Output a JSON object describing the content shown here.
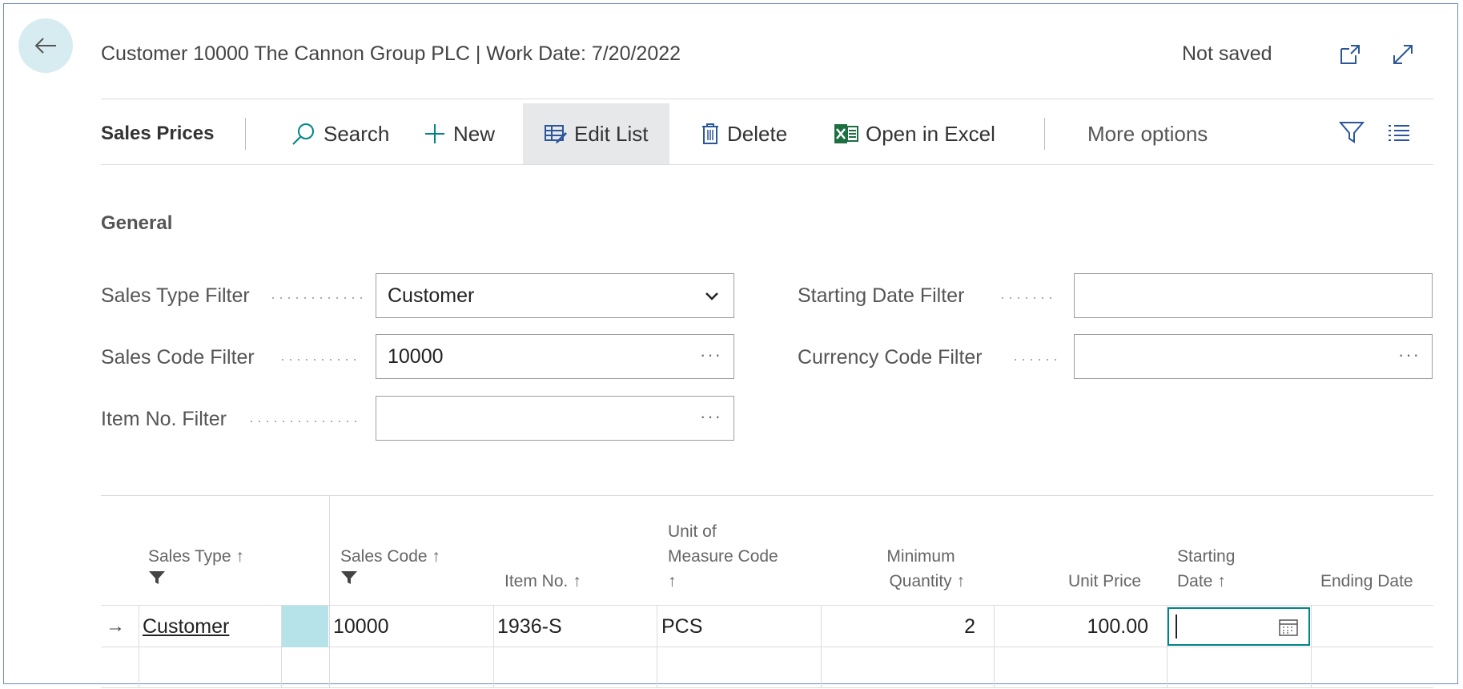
{
  "header": {
    "title": "Customer 10000 The Cannon Group PLC | Work Date: 7/20/2022",
    "status": "Not saved"
  },
  "actionbar": {
    "page_name": "Sales Prices",
    "search": "Search",
    "new": "New",
    "edit_list": "Edit List",
    "delete": "Delete",
    "open_in_excel": "Open in Excel",
    "more_options": "More options"
  },
  "general": {
    "section_title": "General",
    "sales_type_filter": {
      "label": "Sales Type Filter",
      "value": "Customer"
    },
    "sales_code_filter": {
      "label": "Sales Code Filter",
      "value": "10000"
    },
    "item_no_filter": {
      "label": "Item No. Filter",
      "value": ""
    },
    "starting_date_filter": {
      "label": "Starting Date Filter",
      "value": ""
    },
    "currency_code_filter": {
      "label": "Currency Code Filter",
      "value": ""
    }
  },
  "table": {
    "columns": {
      "sales_type": "Sales Type ↑",
      "sales_code": "Sales Code ↑",
      "item_no": "Item No. ↑",
      "uom_line1": "Unit of",
      "uom_line2": "Measure Code",
      "uom_line3": "↑",
      "min_qty_line1": "Minimum",
      "min_qty_line2": "Quantity ↑",
      "unit_price": "Unit Price",
      "starting_date_line1": "Starting",
      "starting_date_line2": "Date ↑",
      "ending_date": "Ending Date"
    },
    "rows": [
      {
        "indicator": "→",
        "sales_type": "Customer",
        "sales_code": "10000",
        "item_no": "1936-S",
        "uom": "PCS",
        "min_qty": "2",
        "unit_price": "100.00",
        "starting_date": "",
        "ending_date": ""
      }
    ]
  },
  "colors": {
    "accent": "#008489",
    "selection": "#b6e3ea",
    "excel_green": "#1d6f42"
  }
}
